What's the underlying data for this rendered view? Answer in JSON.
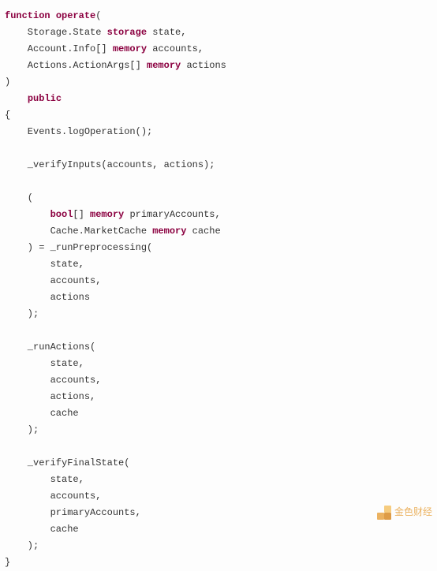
{
  "code": {
    "tokens": [
      {
        "kind": "kw",
        "text": "function"
      },
      {
        "kind": "plain",
        "text": " "
      },
      {
        "kind": "fn",
        "text": "operate"
      },
      {
        "kind": "plain",
        "text": "("
      },
      {
        "kind": "nl"
      },
      {
        "kind": "plain",
        "text": "    Storage.State "
      },
      {
        "kind": "kw",
        "text": "storage"
      },
      {
        "kind": "plain",
        "text": " state,"
      },
      {
        "kind": "nl"
      },
      {
        "kind": "plain",
        "text": "    Account.Info[] "
      },
      {
        "kind": "kw",
        "text": "memory"
      },
      {
        "kind": "plain",
        "text": " accounts,"
      },
      {
        "kind": "nl"
      },
      {
        "kind": "plain",
        "text": "    Actions.ActionArgs[] "
      },
      {
        "kind": "kw",
        "text": "memory"
      },
      {
        "kind": "plain",
        "text": " actions"
      },
      {
        "kind": "nl"
      },
      {
        "kind": "plain",
        "text": ")"
      },
      {
        "kind": "nl"
      },
      {
        "kind": "plain",
        "text": "    "
      },
      {
        "kind": "kw",
        "text": "public"
      },
      {
        "kind": "nl"
      },
      {
        "kind": "plain",
        "text": "{"
      },
      {
        "kind": "nl"
      },
      {
        "kind": "plain",
        "text": "    Events.logOperation();"
      },
      {
        "kind": "nl"
      },
      {
        "kind": "nl"
      },
      {
        "kind": "plain",
        "text": "    _verifyInputs(accounts, actions);"
      },
      {
        "kind": "nl"
      },
      {
        "kind": "nl"
      },
      {
        "kind": "plain",
        "text": "    ("
      },
      {
        "kind": "nl"
      },
      {
        "kind": "plain",
        "text": "        "
      },
      {
        "kind": "kw",
        "text": "bool"
      },
      {
        "kind": "plain",
        "text": "[] "
      },
      {
        "kind": "kw",
        "text": "memory"
      },
      {
        "kind": "plain",
        "text": " primaryAccounts,"
      },
      {
        "kind": "nl"
      },
      {
        "kind": "plain",
        "text": "        Cache.MarketCache "
      },
      {
        "kind": "kw",
        "text": "memory"
      },
      {
        "kind": "plain",
        "text": " cache"
      },
      {
        "kind": "nl"
      },
      {
        "kind": "plain",
        "text": "    ) = _runPreprocessing("
      },
      {
        "kind": "nl"
      },
      {
        "kind": "plain",
        "text": "        state,"
      },
      {
        "kind": "nl"
      },
      {
        "kind": "plain",
        "text": "        accounts,"
      },
      {
        "kind": "nl"
      },
      {
        "kind": "plain",
        "text": "        actions"
      },
      {
        "kind": "nl"
      },
      {
        "kind": "plain",
        "text": "    );"
      },
      {
        "kind": "nl"
      },
      {
        "kind": "nl"
      },
      {
        "kind": "plain",
        "text": "    _runActions("
      },
      {
        "kind": "nl"
      },
      {
        "kind": "plain",
        "text": "        state,"
      },
      {
        "kind": "nl"
      },
      {
        "kind": "plain",
        "text": "        accounts,"
      },
      {
        "kind": "nl"
      },
      {
        "kind": "plain",
        "text": "        actions,"
      },
      {
        "kind": "nl"
      },
      {
        "kind": "plain",
        "text": "        cache"
      },
      {
        "kind": "nl"
      },
      {
        "kind": "plain",
        "text": "    );"
      },
      {
        "kind": "nl"
      },
      {
        "kind": "nl"
      },
      {
        "kind": "plain",
        "text": "    _verifyFinalState("
      },
      {
        "kind": "nl"
      },
      {
        "kind": "plain",
        "text": "        state,"
      },
      {
        "kind": "nl"
      },
      {
        "kind": "plain",
        "text": "        accounts,"
      },
      {
        "kind": "nl"
      },
      {
        "kind": "plain",
        "text": "        primaryAccounts,"
      },
      {
        "kind": "nl"
      },
      {
        "kind": "plain",
        "text": "        cache"
      },
      {
        "kind": "nl"
      },
      {
        "kind": "plain",
        "text": "    );"
      },
      {
        "kind": "nl"
      },
      {
        "kind": "plain",
        "text": "}"
      }
    ]
  },
  "watermark": {
    "text": "金色财经"
  }
}
